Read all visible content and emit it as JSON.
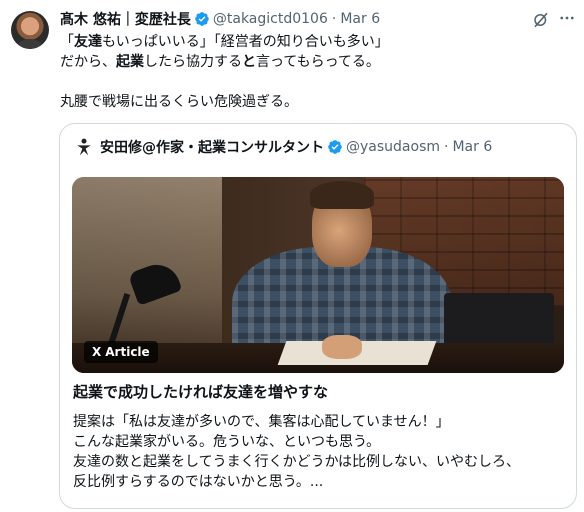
{
  "tweet": {
    "author_name": "髙木 悠祐｜変歴社長",
    "author_handle": "@takagictd0106",
    "separator": "·",
    "date": "Mar 6",
    "body_lines": [
      [
        "「",
        "友達",
        "もいっぱいいる」「経営者の知り合いも多い」"
      ],
      [
        "だから、",
        "起業",
        "したら協力する",
        "と",
        "言ってもらってる。"
      ],
      [
        "丸腰で戦場に出るくらい危険過ぎる。"
      ]
    ]
  },
  "quoted": {
    "author_name": "安田修@作家・起業コンサルタント",
    "author_handle": "@yasudaosm",
    "separator": "·",
    "date": "Mar 6",
    "article_badge": "Article",
    "article_badge_icon": "X",
    "article_title": "起業で成功したければ友達を増やすな",
    "article_excerpt_lines": [
      "提案は「私は友達が多いので、集客は心配していません！」",
      "こんな起業家がいる。危ういな、といつも思う。",
      "友達の数と起業をしてうまく行くかどうかは比例しない、いやむしろ、",
      "反比例すらするのではないかと思う。..."
    ]
  },
  "icons": {
    "verified": "verified-badge-icon",
    "grok": "grok-icon",
    "more": "more-options-icon"
  },
  "colors": {
    "text": "#0f1419",
    "secondary": "#536471",
    "verified": "#1d9bf0",
    "border": "#cfd9de"
  }
}
